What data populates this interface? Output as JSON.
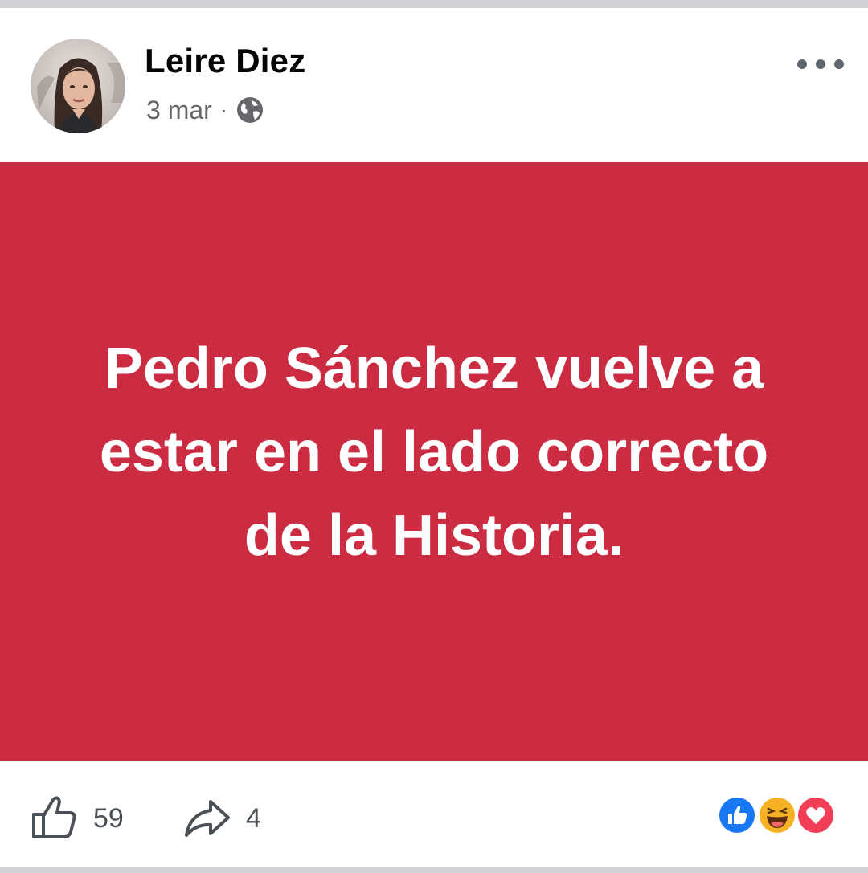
{
  "author": {
    "name": "Leire Diez",
    "date": "3 mar",
    "separator": "·",
    "privacy_icon": "globe-icon"
  },
  "post": {
    "background_color": "#cc2c42",
    "text": "Pedro Sánchez vuelve a estar en el lado correcto de la Historia."
  },
  "footer": {
    "likes_count": "59",
    "shares_count": "4",
    "like_icon": "thumbs-up-icon",
    "share_icon": "share-arrow-icon",
    "reactions": [
      "like",
      "haha",
      "love"
    ]
  },
  "colors": {
    "like_blue": "#1877f2",
    "love_red": "#f33e58",
    "haha_yellow": "#f7b125"
  }
}
